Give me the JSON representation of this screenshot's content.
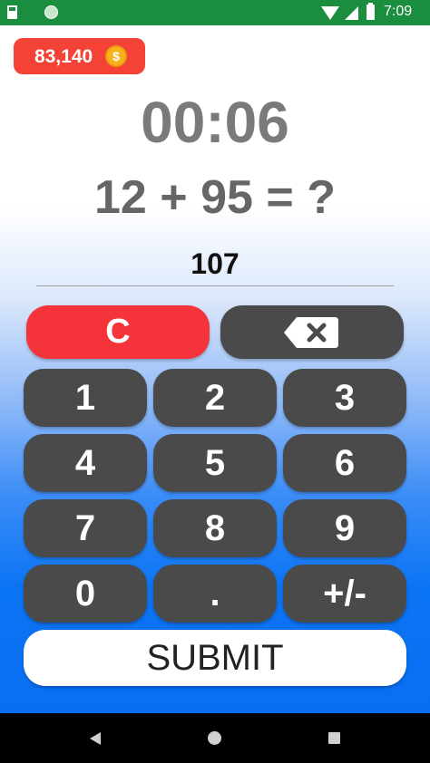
{
  "status_bar": {
    "time": "7:09"
  },
  "coins": {
    "amount": "83,140",
    "coin_symbol": "$"
  },
  "game": {
    "timer": "00:06",
    "question": "12 + 95 = ?",
    "answer": "107"
  },
  "keypad": {
    "clear_label": "C",
    "keys": [
      "1",
      "2",
      "3",
      "4",
      "5",
      "6",
      "7",
      "8",
      "9",
      "0",
      ".",
      "+/-"
    ],
    "submit_label": "SUBMIT"
  },
  "colors": {
    "status_bar": "#1b8d3f",
    "coin_badge": "#f44336",
    "clear_button": "#f4333a",
    "key_background": "#4a4a4a",
    "gradient_bottom": "#0a6ef2"
  }
}
